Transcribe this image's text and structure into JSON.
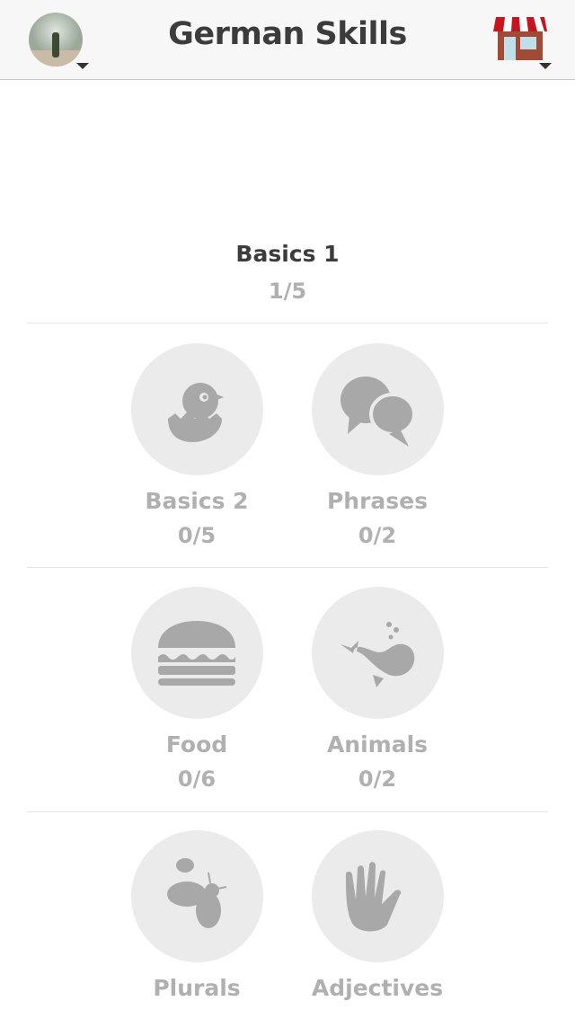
{
  "header": {
    "title": "German Skills",
    "avatar_icon": "user-avatar",
    "shop_icon": "store-icon"
  },
  "top_skill": {
    "name": "Basics 1",
    "progress": "1/5"
  },
  "rows": [
    [
      {
        "name": "Basics 2",
        "progress": "0/5",
        "icon": "hatching-chick-icon"
      },
      {
        "name": "Phrases",
        "progress": "0/2",
        "icon": "speech-bubbles-icon"
      }
    ],
    [
      {
        "name": "Food",
        "progress": "0/6",
        "icon": "burger-icon"
      },
      {
        "name": "Animals",
        "progress": "0/2",
        "icon": "whale-icon"
      }
    ],
    [
      {
        "name": "Plurals",
        "progress": "",
        "icon": "bugs-icon"
      },
      {
        "name": "Adjectives",
        "progress": "",
        "icon": "hand-icon"
      }
    ]
  ],
  "colors": {
    "icon_gray": "#a8a8a8",
    "circle_bg": "#ebebeb",
    "title": "#3c3c3c"
  }
}
